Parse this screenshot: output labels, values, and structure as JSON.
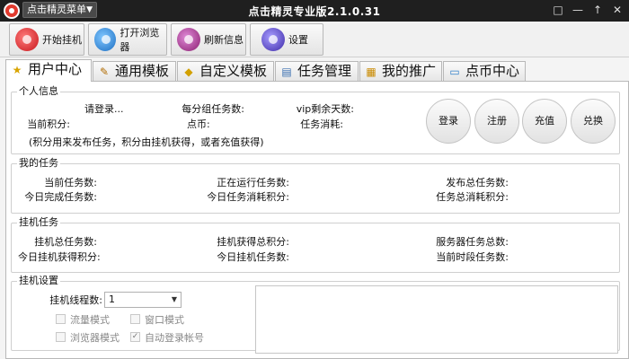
{
  "window": {
    "title": "点击精灵专业版2.1.0.31",
    "menu_label": "点击精灵菜单",
    "menu_caret": "▼",
    "controls": {
      "restore": "□",
      "minimize": "—",
      "maximize": "↑",
      "close": "✕"
    }
  },
  "toolbar": {
    "start": "开始挂机",
    "open_browser": "打开浏览器",
    "refresh": "刷新信息",
    "settings": "设置"
  },
  "tabs": [
    {
      "label": "用户中心",
      "icon": "★",
      "icon_name": "star-icon"
    },
    {
      "label": "通用模板",
      "icon": "✎",
      "icon_name": "pencil-icon"
    },
    {
      "label": "自定义模板",
      "icon": "◆",
      "icon_name": "template-icon"
    },
    {
      "label": "任务管理",
      "icon": "▤",
      "icon_name": "document-icon"
    },
    {
      "label": "我的推广",
      "icon": "▦",
      "icon_name": "promotion-icon"
    },
    {
      "label": "点币中心",
      "icon": "▭",
      "icon_name": "coin-icon"
    }
  ],
  "personal": {
    "title": "个人信息",
    "login_prompt": "请登录...",
    "per_group_tasks": "每分组任务数:",
    "vip_days": "vip剩余天数:",
    "current_points": "当前积分:",
    "coins": "点币:",
    "task_consumption": "任务消耗:",
    "note": "(积分用来发布任务，积分由挂机获得，或者充值获得)",
    "buttons": {
      "login": "登录",
      "register": "注册",
      "recharge": "充值",
      "exchange": "兑换"
    }
  },
  "my_tasks": {
    "title": "我的任务",
    "current_tasks": "当前任务数:",
    "running_tasks": "正在运行任务数:",
    "published_total": "发布总任务数:",
    "today_completed": "今日完成任务数:",
    "today_consumed_points": "今日任务消耗积分:",
    "total_consumed_points": "任务总消耗积分:"
  },
  "hangup_tasks": {
    "title": "挂机任务",
    "total_tasks": "挂机总任务数:",
    "total_points": "挂机获得总积分:",
    "server_total": "服务器任务总数:",
    "today_points": "今日挂机获得积分:",
    "today_tasks": "今日挂机任务数:",
    "current_period": "当前时段任务数:"
  },
  "hangup_settings": {
    "title": "挂机设置",
    "threads_label": "挂机线程数:",
    "threads_value": "1",
    "options": [
      {
        "label": "流量模式",
        "checked": false
      },
      {
        "label": "窗口模式",
        "checked": false
      },
      {
        "label": "浏览器模式",
        "checked": false
      },
      {
        "label": "自动登录帐号",
        "checked": true
      }
    ]
  }
}
